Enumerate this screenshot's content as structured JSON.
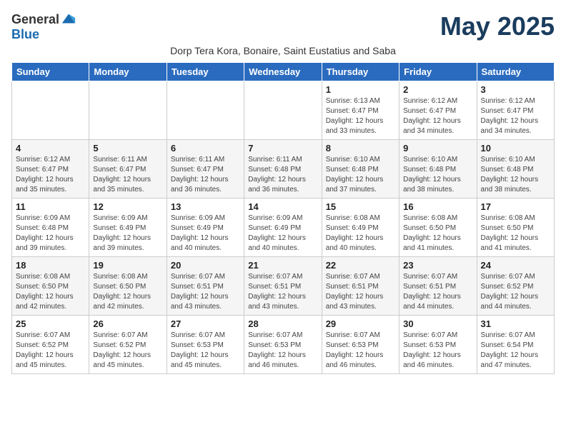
{
  "header": {
    "logo_general": "General",
    "logo_blue": "Blue",
    "month_title": "May 2025",
    "subtitle": "Dorp Tera Kora, Bonaire, Saint Eustatius and Saba"
  },
  "days_of_week": [
    "Sunday",
    "Monday",
    "Tuesday",
    "Wednesday",
    "Thursday",
    "Friday",
    "Saturday"
  ],
  "weeks": [
    [
      {
        "day": "",
        "info": ""
      },
      {
        "day": "",
        "info": ""
      },
      {
        "day": "",
        "info": ""
      },
      {
        "day": "",
        "info": ""
      },
      {
        "day": "1",
        "info": "Sunrise: 6:13 AM\nSunset: 6:47 PM\nDaylight: 12 hours\nand 33 minutes."
      },
      {
        "day": "2",
        "info": "Sunrise: 6:12 AM\nSunset: 6:47 PM\nDaylight: 12 hours\nand 34 minutes."
      },
      {
        "day": "3",
        "info": "Sunrise: 6:12 AM\nSunset: 6:47 PM\nDaylight: 12 hours\nand 34 minutes."
      }
    ],
    [
      {
        "day": "4",
        "info": "Sunrise: 6:12 AM\nSunset: 6:47 PM\nDaylight: 12 hours\nand 35 minutes."
      },
      {
        "day": "5",
        "info": "Sunrise: 6:11 AM\nSunset: 6:47 PM\nDaylight: 12 hours\nand 35 minutes."
      },
      {
        "day": "6",
        "info": "Sunrise: 6:11 AM\nSunset: 6:47 PM\nDaylight: 12 hours\nand 36 minutes."
      },
      {
        "day": "7",
        "info": "Sunrise: 6:11 AM\nSunset: 6:48 PM\nDaylight: 12 hours\nand 36 minutes."
      },
      {
        "day": "8",
        "info": "Sunrise: 6:10 AM\nSunset: 6:48 PM\nDaylight: 12 hours\nand 37 minutes."
      },
      {
        "day": "9",
        "info": "Sunrise: 6:10 AM\nSunset: 6:48 PM\nDaylight: 12 hours\nand 38 minutes."
      },
      {
        "day": "10",
        "info": "Sunrise: 6:10 AM\nSunset: 6:48 PM\nDaylight: 12 hours\nand 38 minutes."
      }
    ],
    [
      {
        "day": "11",
        "info": "Sunrise: 6:09 AM\nSunset: 6:48 PM\nDaylight: 12 hours\nand 39 minutes."
      },
      {
        "day": "12",
        "info": "Sunrise: 6:09 AM\nSunset: 6:49 PM\nDaylight: 12 hours\nand 39 minutes."
      },
      {
        "day": "13",
        "info": "Sunrise: 6:09 AM\nSunset: 6:49 PM\nDaylight: 12 hours\nand 40 minutes."
      },
      {
        "day": "14",
        "info": "Sunrise: 6:09 AM\nSunset: 6:49 PM\nDaylight: 12 hours\nand 40 minutes."
      },
      {
        "day": "15",
        "info": "Sunrise: 6:08 AM\nSunset: 6:49 PM\nDaylight: 12 hours\nand 40 minutes."
      },
      {
        "day": "16",
        "info": "Sunrise: 6:08 AM\nSunset: 6:50 PM\nDaylight: 12 hours\nand 41 minutes."
      },
      {
        "day": "17",
        "info": "Sunrise: 6:08 AM\nSunset: 6:50 PM\nDaylight: 12 hours\nand 41 minutes."
      }
    ],
    [
      {
        "day": "18",
        "info": "Sunrise: 6:08 AM\nSunset: 6:50 PM\nDaylight: 12 hours\nand 42 minutes."
      },
      {
        "day": "19",
        "info": "Sunrise: 6:08 AM\nSunset: 6:50 PM\nDaylight: 12 hours\nand 42 minutes."
      },
      {
        "day": "20",
        "info": "Sunrise: 6:07 AM\nSunset: 6:51 PM\nDaylight: 12 hours\nand 43 minutes."
      },
      {
        "day": "21",
        "info": "Sunrise: 6:07 AM\nSunset: 6:51 PM\nDaylight: 12 hours\nand 43 minutes."
      },
      {
        "day": "22",
        "info": "Sunrise: 6:07 AM\nSunset: 6:51 PM\nDaylight: 12 hours\nand 43 minutes."
      },
      {
        "day": "23",
        "info": "Sunrise: 6:07 AM\nSunset: 6:51 PM\nDaylight: 12 hours\nand 44 minutes."
      },
      {
        "day": "24",
        "info": "Sunrise: 6:07 AM\nSunset: 6:52 PM\nDaylight: 12 hours\nand 44 minutes."
      }
    ],
    [
      {
        "day": "25",
        "info": "Sunrise: 6:07 AM\nSunset: 6:52 PM\nDaylight: 12 hours\nand 45 minutes."
      },
      {
        "day": "26",
        "info": "Sunrise: 6:07 AM\nSunset: 6:52 PM\nDaylight: 12 hours\nand 45 minutes."
      },
      {
        "day": "27",
        "info": "Sunrise: 6:07 AM\nSunset: 6:53 PM\nDaylight: 12 hours\nand 45 minutes."
      },
      {
        "day": "28",
        "info": "Sunrise: 6:07 AM\nSunset: 6:53 PM\nDaylight: 12 hours\nand 46 minutes."
      },
      {
        "day": "29",
        "info": "Sunrise: 6:07 AM\nSunset: 6:53 PM\nDaylight: 12 hours\nand 46 minutes."
      },
      {
        "day": "30",
        "info": "Sunrise: 6:07 AM\nSunset: 6:53 PM\nDaylight: 12 hours\nand 46 minutes."
      },
      {
        "day": "31",
        "info": "Sunrise: 6:07 AM\nSunset: 6:54 PM\nDaylight: 12 hours\nand 47 minutes."
      }
    ]
  ]
}
